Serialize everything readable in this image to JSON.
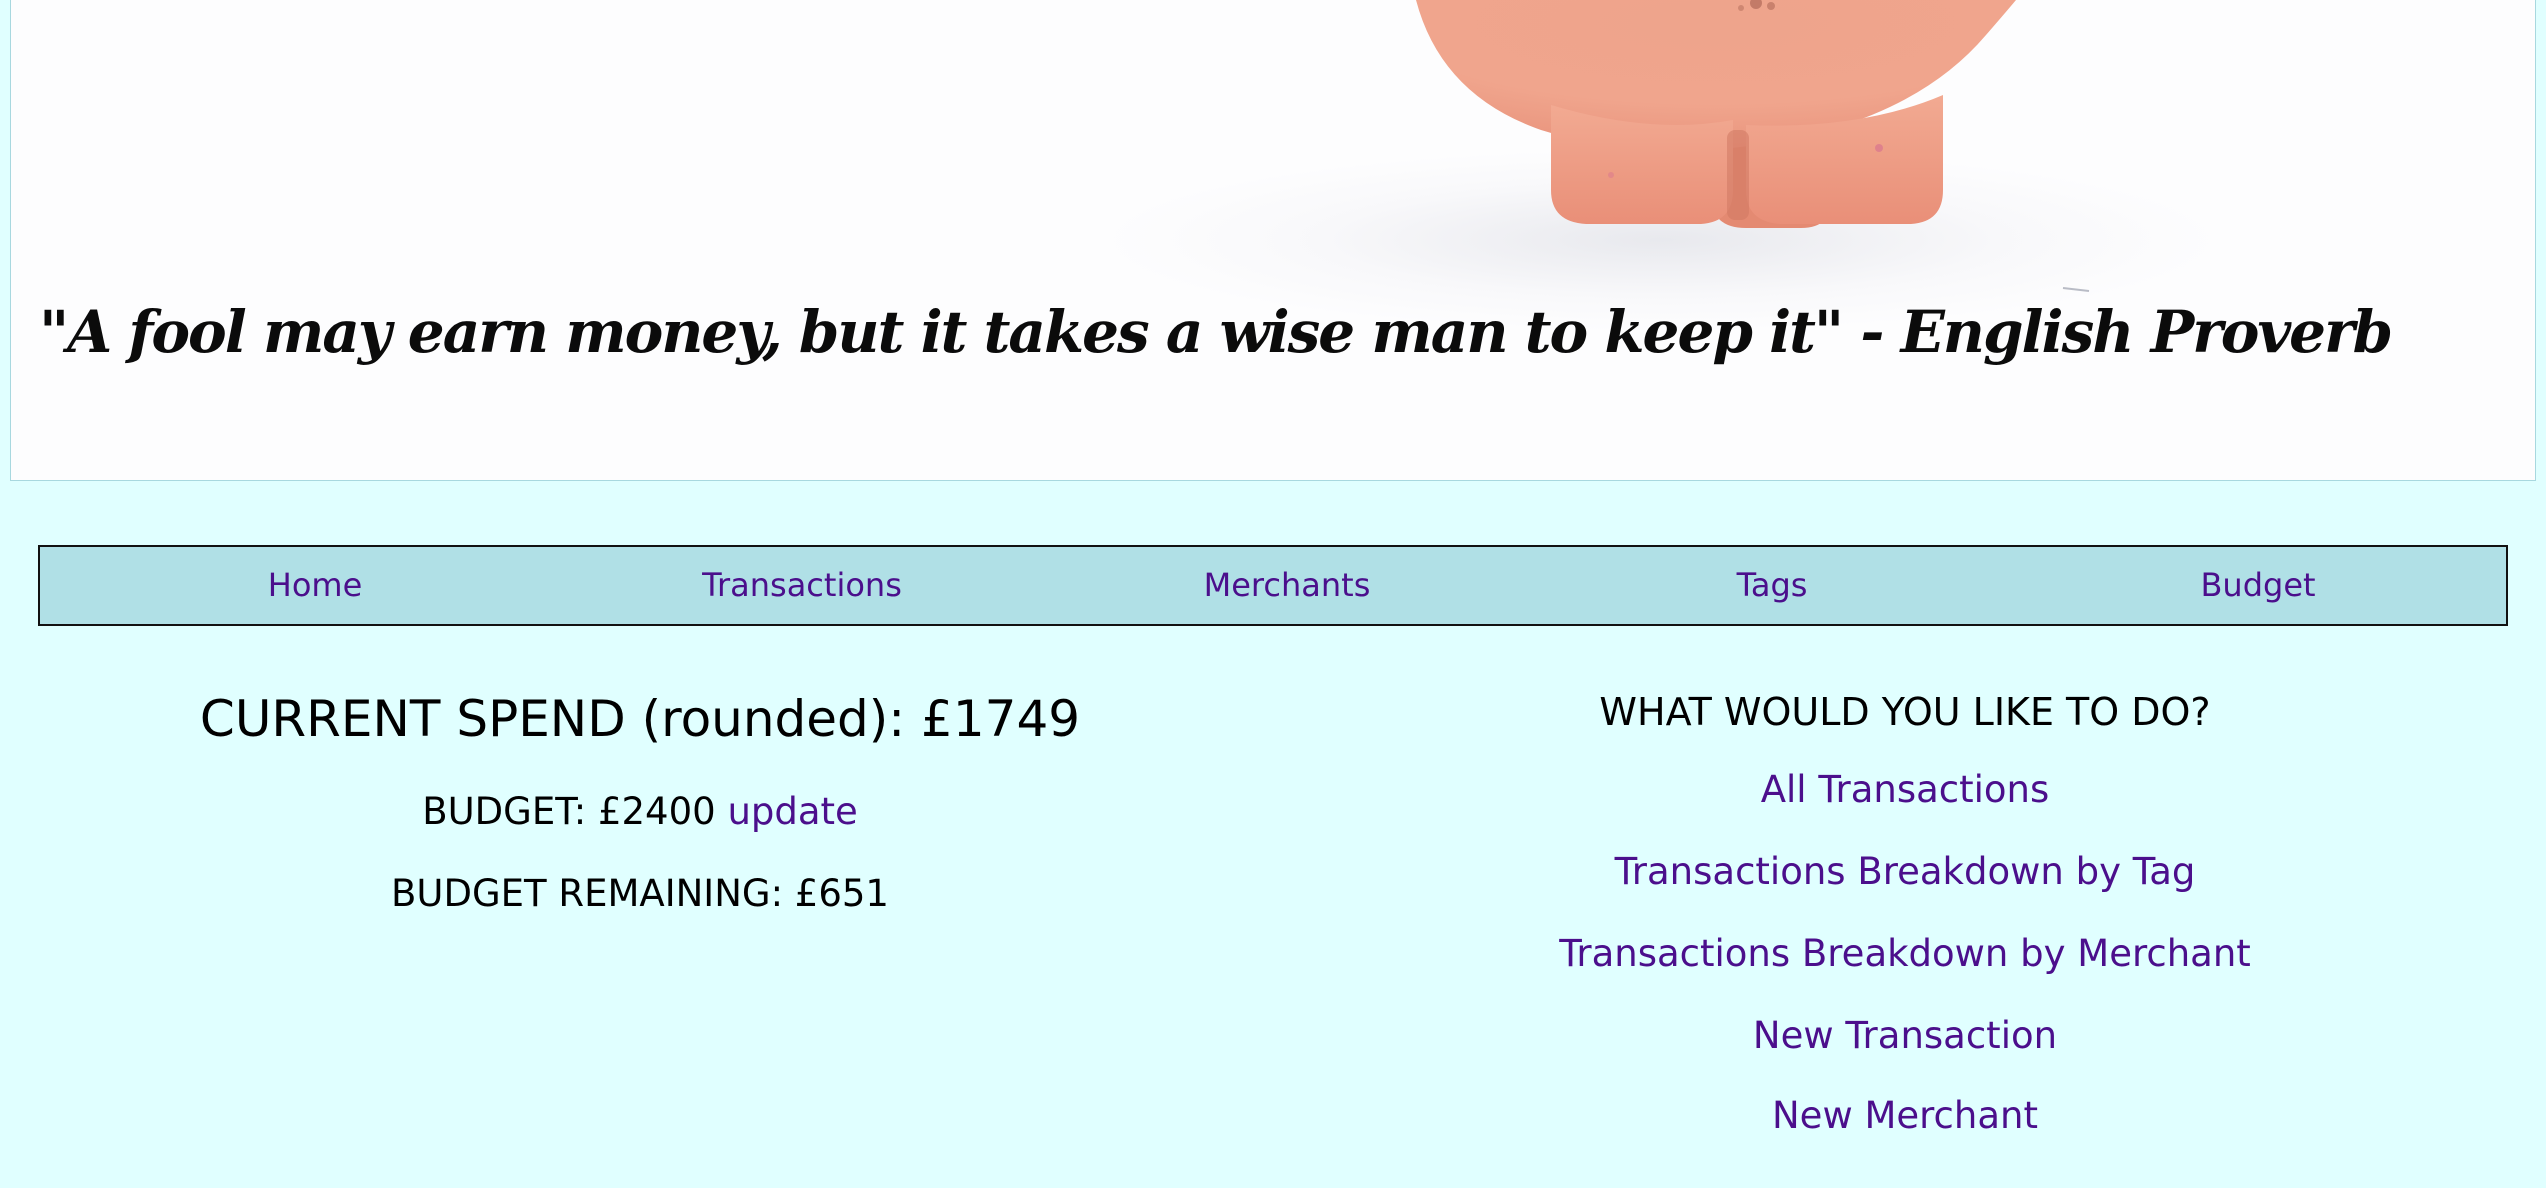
{
  "header": {
    "quote": "\"A fool may earn money, but it takes a wise man to keep it\" - English Proverb",
    "image_icon": "piggy-bank-icon"
  },
  "nav": {
    "items": [
      {
        "label": "Home"
      },
      {
        "label": "Transactions"
      },
      {
        "label": "Merchants"
      },
      {
        "label": "Tags"
      },
      {
        "label": "Budget"
      }
    ]
  },
  "summary": {
    "current_spend": "CURRENT SPEND (rounded): £1749",
    "budget": "BUDGET: £2400",
    "update_link": "update",
    "budget_remaining": "BUDGET REMAINING: £651"
  },
  "actions": {
    "heading": "WHAT WOULD YOU LIKE TO DO?",
    "links": [
      {
        "label": "All Transactions"
      },
      {
        "label": "Transactions Breakdown by Tag"
      },
      {
        "label": "Transactions Breakdown by Merchant"
      },
      {
        "label": "New Transaction"
      },
      {
        "label": "New Merchant"
      }
    ]
  },
  "colors": {
    "page_background": "#e0ffff",
    "nav_background": "#b0e0e6",
    "link": "#4b0f8c",
    "piggy_bank": "#f4a98f"
  }
}
